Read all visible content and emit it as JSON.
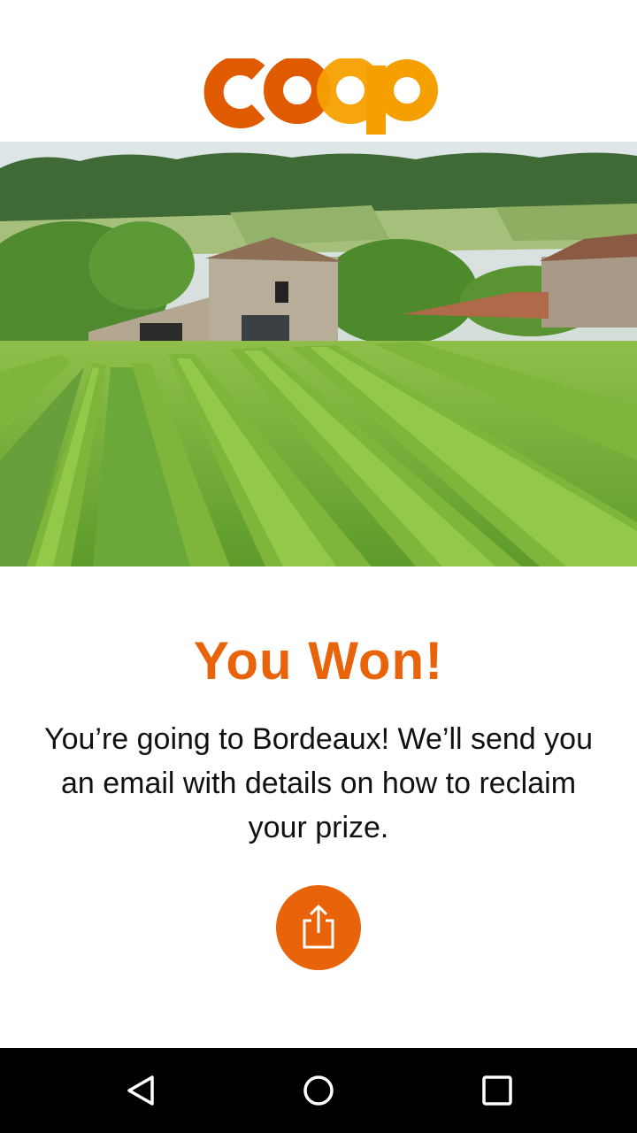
{
  "header": {
    "logo_text": "coop",
    "logo_colors": {
      "dark": "#e05a00",
      "light": "#f5a000"
    }
  },
  "hero": {
    "icon": "vineyard-photo"
  },
  "result": {
    "title": "You Won!",
    "message": "You’re going to Bordeaux! We’ll send you an email with details on how to reclaim your prize."
  },
  "share": {
    "icon": "share-icon",
    "color": "#e8630a"
  },
  "navbar": {
    "back_icon": "back-icon",
    "home_icon": "home-icon",
    "recents_icon": "recents-icon"
  }
}
